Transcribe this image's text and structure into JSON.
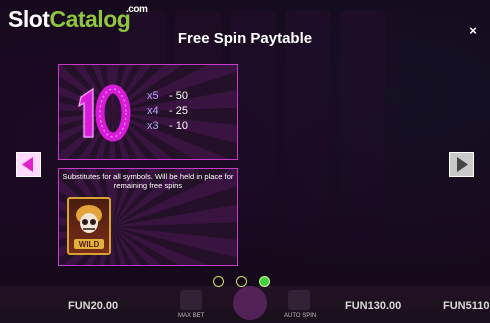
{
  "brand": {
    "slot": "Slot",
    "catalog": "Catalog",
    "dotcom": ".com"
  },
  "modal": {
    "title": "Free Spin Paytable",
    "close_glyph": "×"
  },
  "paytable": {
    "symbol": "10",
    "pays": [
      {
        "mult": "x5",
        "value": "- 50"
      },
      {
        "mult": "x4",
        "value": "- 25"
      },
      {
        "mult": "x3",
        "value": "- 10"
      }
    ]
  },
  "wild": {
    "description": "Substitutes for all symbols. Will be held in place for remaining free spins",
    "label": "WILD"
  },
  "pagination": {
    "pages": 3,
    "active": 3
  },
  "bottom_bar": {
    "bet_amount": "FUN20.00",
    "max_bet_label": "MAX BET",
    "auto_spin_label": "AUTO SPIN",
    "win_amount": "FUN130.00",
    "balance_amount": "FUN5110"
  },
  "colors": {
    "accent": "#c53ac9",
    "logo_green": "#8ec63f",
    "dot_active": "#3cd23c"
  }
}
